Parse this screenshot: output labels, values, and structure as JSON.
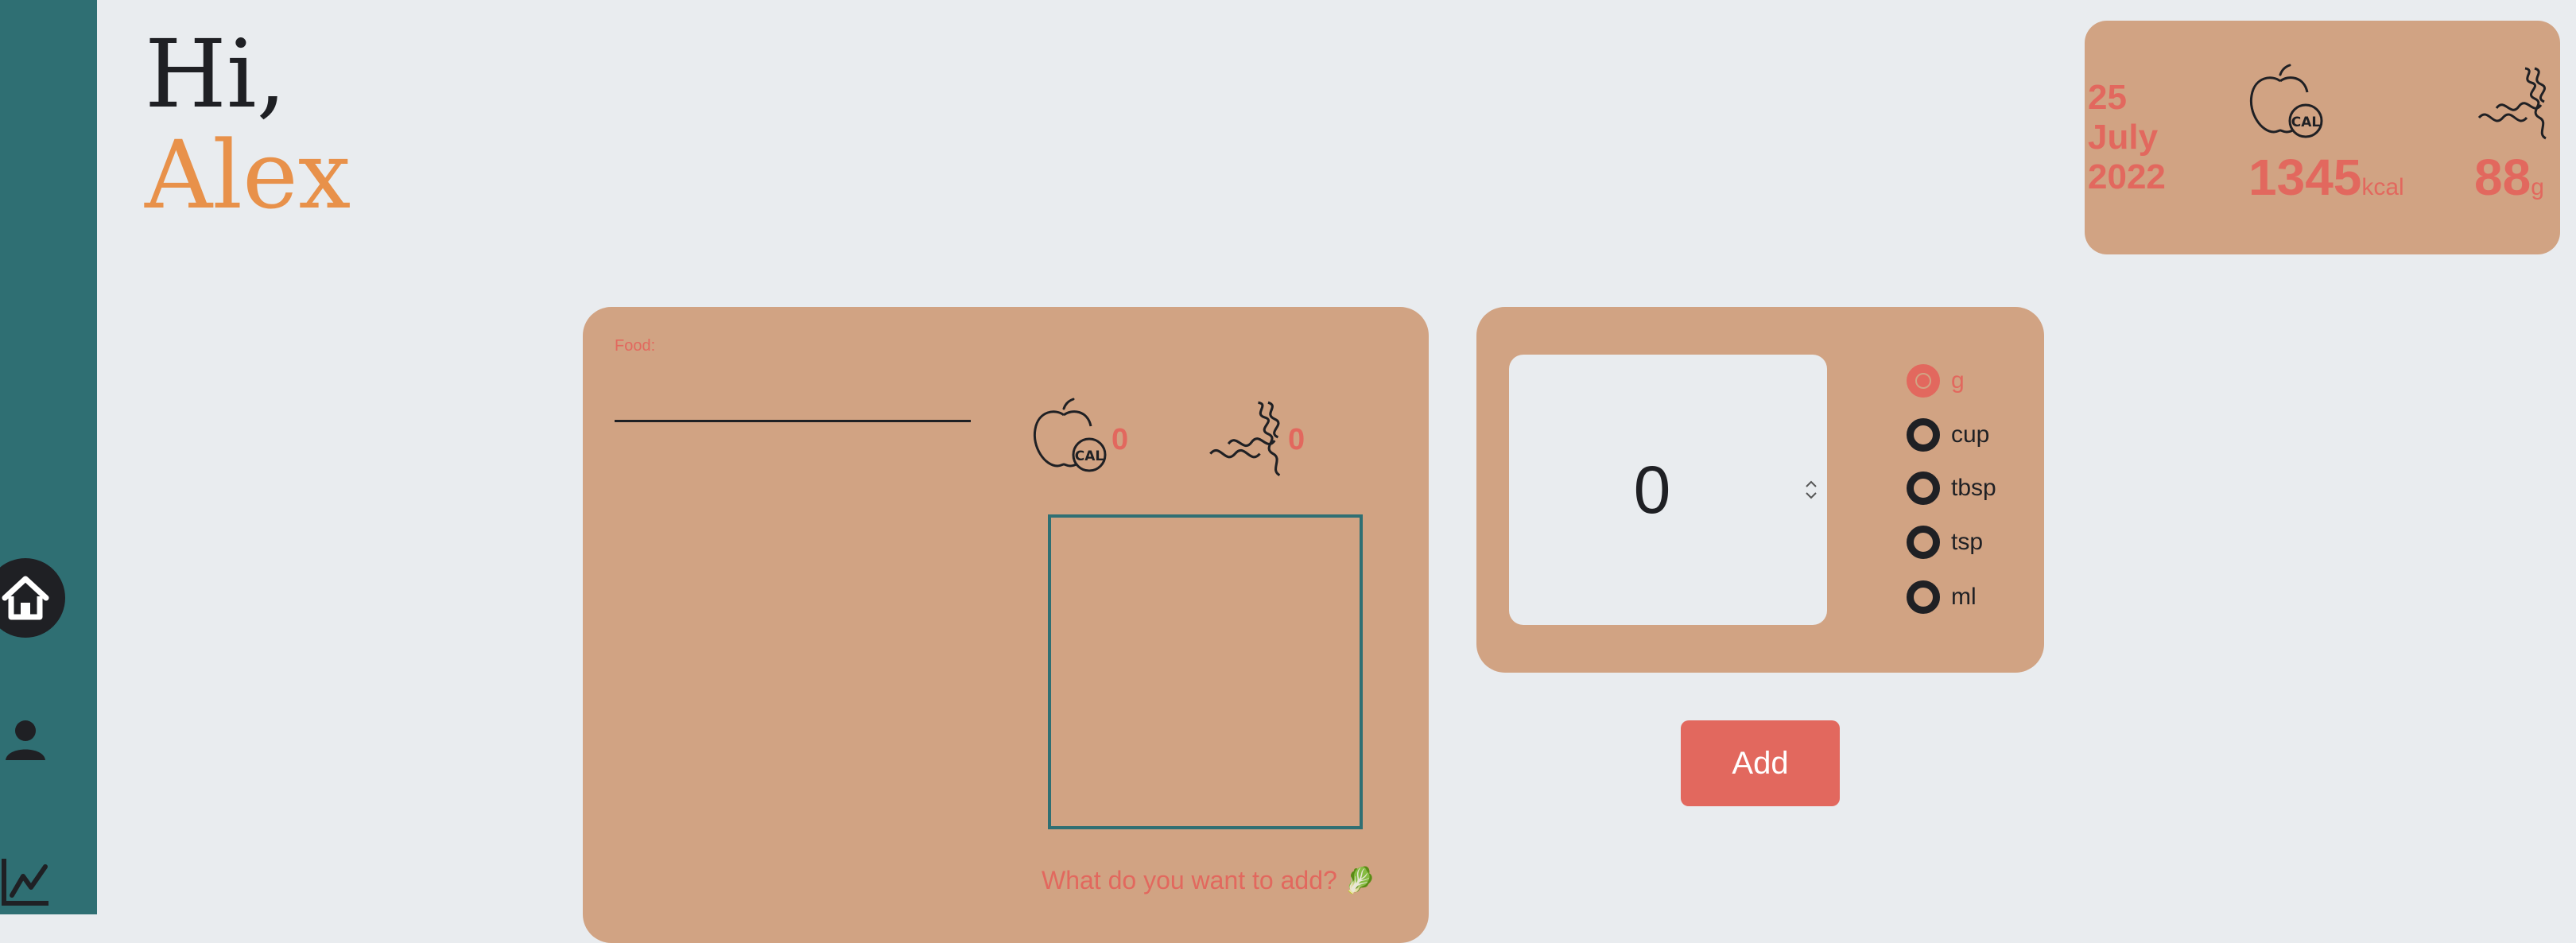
{
  "greeting": {
    "hi": "Hi,",
    "name": "Alex"
  },
  "sidebar": {
    "items": [
      {
        "icon": "home-icon",
        "active": true
      },
      {
        "icon": "user-icon",
        "active": false
      },
      {
        "icon": "chart-icon",
        "active": false
      }
    ]
  },
  "summary": {
    "date": {
      "day": "25",
      "month": "July",
      "year": "2022"
    },
    "calories": {
      "value": "1345",
      "unit": "kcal",
      "icon": "calorie-apple-icon"
    },
    "protein": {
      "value": "88",
      "unit": "g",
      "icon": "protein-helix-icon"
    }
  },
  "food": {
    "label": "Food:",
    "input_value": "",
    "calories": "0",
    "protein": "0",
    "prompt": "What do you want to add? 🥬"
  },
  "quantity": {
    "value": "0",
    "units": [
      "g",
      "cup",
      "tbsp",
      "tsp",
      "ml"
    ],
    "selected_unit": "g"
  },
  "add_button": {
    "label": "Add"
  },
  "colors": {
    "sidebar": "#2f6f73",
    "card": "#d1a383",
    "accent": "#e2685e",
    "name": "#e8914a",
    "background": "#e9ecef"
  }
}
